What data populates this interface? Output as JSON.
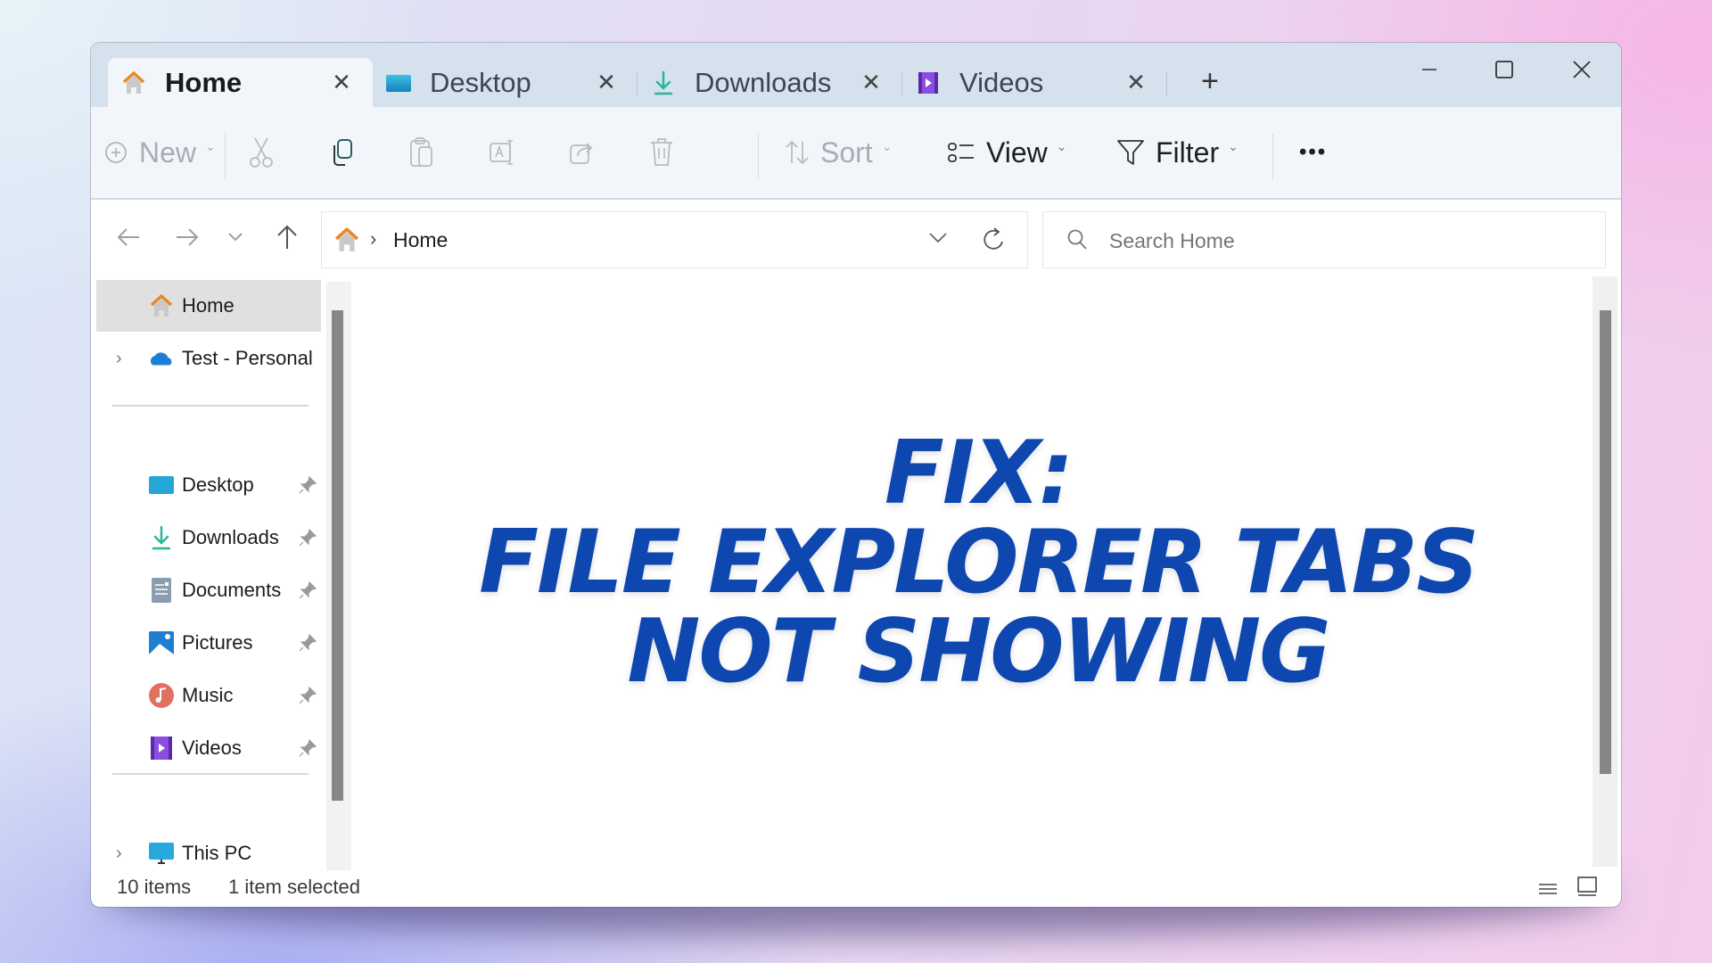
{
  "window": {
    "tabs": [
      {
        "label": "Home",
        "icon": "home-icon",
        "active": true
      },
      {
        "label": "Desktop",
        "icon": "desktop-folder-icon",
        "active": false
      },
      {
        "label": "Downloads",
        "icon": "download-icon",
        "active": false
      },
      {
        "label": "Videos",
        "icon": "videos-icon",
        "active": false
      }
    ],
    "new_tab_label": "+",
    "tab_close_glyph": "✕",
    "controls": {
      "minimize": "minimize",
      "maximize": "maximize",
      "close": "close"
    }
  },
  "toolbar": {
    "new_label": "New",
    "sort_label": "Sort",
    "view_label": "View",
    "filter_label": "Filter",
    "more_label": "•••",
    "icons": [
      "plus-circle-icon",
      "cut-icon",
      "copy-icon",
      "paste-icon",
      "rename-icon",
      "share-icon",
      "delete-icon",
      "sort-icon",
      "view-icon",
      "filter-icon",
      "more-icon"
    ]
  },
  "nav": {
    "breadcrumb": [
      "Home"
    ],
    "search_placeholder": "Search Home"
  },
  "sidebar": {
    "top_items": [
      {
        "label": "Home",
        "icon": "home-icon",
        "selected": true,
        "expandable": false
      },
      {
        "label": "Test - Personal",
        "icon": "onedrive-cloud-icon",
        "selected": false,
        "expandable": true
      }
    ],
    "pinned_items": [
      {
        "label": "Desktop",
        "icon": "desktop-folder-icon",
        "pinned": true
      },
      {
        "label": "Downloads",
        "icon": "download-icon",
        "pinned": true
      },
      {
        "label": "Documents",
        "icon": "documents-icon",
        "pinned": true
      },
      {
        "label": "Pictures",
        "icon": "pictures-icon",
        "pinned": true
      },
      {
        "label": "Music",
        "icon": "music-icon",
        "pinned": true
      },
      {
        "label": "Videos",
        "icon": "videos-icon",
        "pinned": true
      }
    ],
    "bottom_items": [
      {
        "label": "This PC",
        "icon": "monitor-icon",
        "expandable": true
      }
    ]
  },
  "content": {
    "headline_lines": [
      "FIX:",
      "FILE EXPLORER TABS",
      "NOT SHOWING"
    ],
    "headline_color": "#0e47b0"
  },
  "status": {
    "item_count": "10 items",
    "selection": "1 item selected"
  }
}
